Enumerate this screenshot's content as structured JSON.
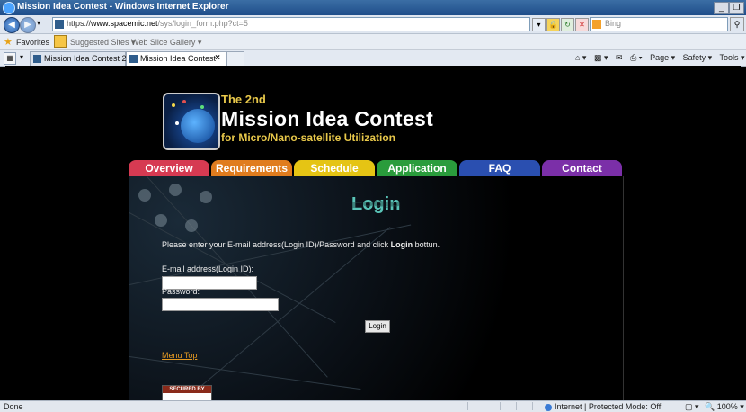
{
  "window": {
    "title": "Mission Idea Contest - Windows Internet Explorer",
    "controls": [
      "_",
      "❐"
    ]
  },
  "address_bar": {
    "url_prefix": "https://",
    "url_host": "www.spacemic.net",
    "url_path": "/sys/login_form.php?ct=5",
    "search_placeholder": "Bing"
  },
  "favorites_bar": {
    "label": "Favorites",
    "items": [
      "Suggested Sites ▾",
      "Web Slice Gallery ▾"
    ]
  },
  "tabs": [
    {
      "label": "Mission Idea Contest 2",
      "active": false
    },
    {
      "label": "Mission Idea Contest",
      "active": true,
      "close": "×"
    }
  ],
  "command_bar": [
    "Page ▾",
    "Safety ▾",
    "Tools ▾"
  ],
  "site": {
    "logo_line1": "The 2nd",
    "logo_line2": "Mission Idea Contest",
    "logo_line3": "for Micro/Nano-satellite Utilization",
    "nav": [
      {
        "label": "Overview",
        "color": "#d63a52"
      },
      {
        "label": "Requirements",
        "color": "#e07c1e"
      },
      {
        "label": "Schedule",
        "color": "#e5c414"
      },
      {
        "label": "Application",
        "color": "#2a9c3c"
      },
      {
        "label": "FAQ",
        "color": "#2a4fb0"
      },
      {
        "label": "Contact",
        "color": "#7b2fa8"
      }
    ]
  },
  "login": {
    "title": "Login",
    "instruction_pre": "Please enter your E-mail address(Login ID)/Password and click ",
    "instruction_bold": "Login",
    "instruction_post": " bottun.",
    "email_label": "E-mail address(Login ID):",
    "email_value": "",
    "password_label": "Password:",
    "password_value": "",
    "button": "Login",
    "menu_top": "Menu Top",
    "secured_badge": "SECURED BY"
  },
  "status_bar": {
    "left": "Done",
    "zone": "Internet | Protected Mode: Off",
    "zoom": "100%"
  }
}
